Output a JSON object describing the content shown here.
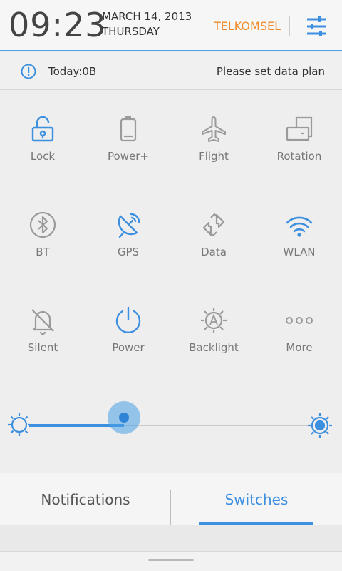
{
  "header": {
    "time": "09:23",
    "date": "MARCH 14, 2013",
    "day": "THURSDAY",
    "carrier": "TELKOMSEL",
    "settings_icon": "sliders-icon",
    "accent_color": "#4aa3e8",
    "carrier_color": "#f0892a"
  },
  "databar": {
    "icon": "info-icon",
    "today": "Today:0B",
    "message": "Please set data plan"
  },
  "toggles": [
    {
      "label": "Lock",
      "icon": "lock-icon",
      "active": true
    },
    {
      "label": "Power+",
      "icon": "battery-icon",
      "active": false
    },
    {
      "label": "Flight",
      "icon": "airplane-icon",
      "active": false
    },
    {
      "label": "Rotation",
      "icon": "rotation-icon",
      "active": false
    },
    {
      "label": "BT",
      "icon": "bluetooth-icon",
      "active": false
    },
    {
      "label": "GPS",
      "icon": "gps-icon",
      "active": true
    },
    {
      "label": "Data",
      "icon": "data-icon",
      "active": false
    },
    {
      "label": "WLAN",
      "icon": "wifi-icon",
      "active": true
    },
    {
      "label": "Silent",
      "icon": "bell-off-icon",
      "active": false
    },
    {
      "label": "Power",
      "icon": "power-icon",
      "active": true
    },
    {
      "label": "Backlight",
      "icon": "backlight-icon",
      "active": false
    },
    {
      "label": "More",
      "icon": "more-icon",
      "active": false
    }
  ],
  "brightness": {
    "min_icon": "brightness-low-icon",
    "max_icon": "brightness-auto-icon",
    "level": 0.34
  },
  "tabs": [
    {
      "label": "Notifications",
      "selected": false
    },
    {
      "label": "Switches",
      "selected": true
    }
  ]
}
